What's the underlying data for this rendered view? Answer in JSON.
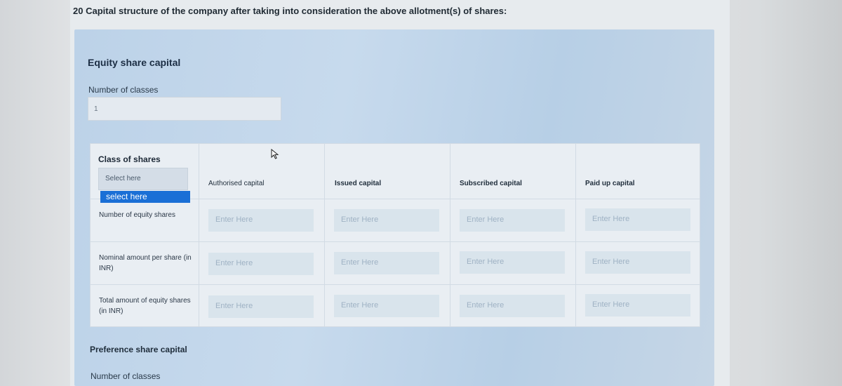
{
  "heading": "20 Capital structure of the company after taking into consideration the above allotment(s) of shares:",
  "equity": {
    "title": "Equity share capital",
    "classes_label": "Number of classes",
    "classes_value": "1",
    "table": {
      "class_title": "Class of shares",
      "select_placeholder": "Select here",
      "select_option": "select here",
      "columns": [
        "Authorised capital",
        "Issued capital",
        "Subscribed capital",
        "Paid up capital"
      ],
      "rows": [
        {
          "label": "Number of equity shares",
          "placeholder": "Enter Here"
        },
        {
          "label": "Nominal amount per share (in INR)",
          "placeholder": "Enter Here"
        },
        {
          "label": "Total amount of equity shares (in INR)",
          "placeholder": "Enter Here"
        }
      ]
    }
  },
  "preference": {
    "title": "Preference share capital",
    "classes_label": "Number of classes"
  },
  "icons": {
    "cursor": "mouse-pointer-icon"
  }
}
